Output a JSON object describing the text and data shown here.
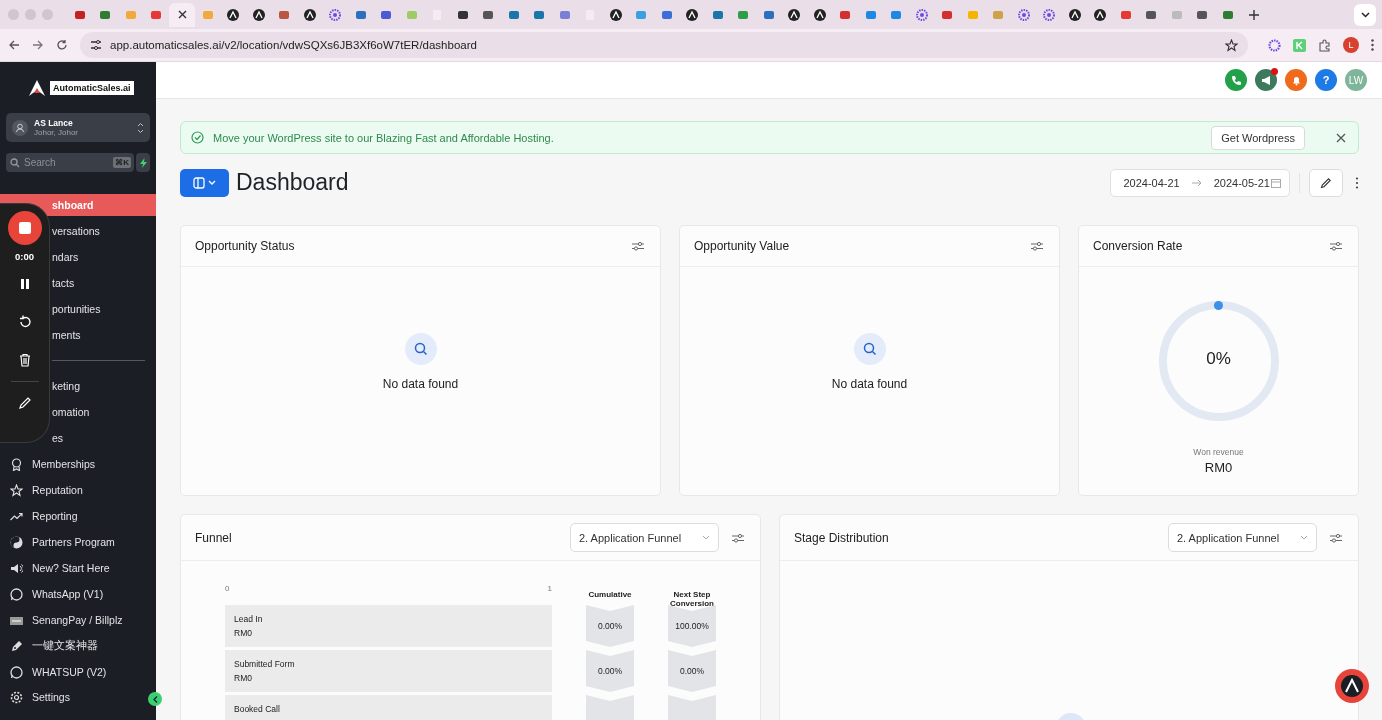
{
  "browser": {
    "tabs": [
      {
        "selected": false
      },
      {
        "selected": false
      },
      {
        "selected": false
      },
      {
        "selected": false
      },
      {
        "selected": true
      },
      {
        "selected": false
      },
      {
        "selected": false
      },
      {
        "selected": false
      },
      {
        "selected": false
      },
      {
        "selected": false
      },
      {
        "selected": false
      },
      {
        "selected": false
      },
      {
        "selected": false
      },
      {
        "selected": false
      },
      {
        "selected": false
      },
      {
        "selected": false
      },
      {
        "selected": false
      },
      {
        "selected": false
      },
      {
        "selected": false
      },
      {
        "selected": false
      },
      {
        "selected": false
      },
      {
        "selected": false
      },
      {
        "selected": false
      },
      {
        "selected": false
      },
      {
        "selected": false
      },
      {
        "selected": false
      },
      {
        "selected": false
      },
      {
        "selected": false
      },
      {
        "selected": false
      },
      {
        "selected": false
      },
      {
        "selected": false
      },
      {
        "selected": false
      },
      {
        "selected": false
      },
      {
        "selected": false
      },
      {
        "selected": false
      },
      {
        "selected": false
      },
      {
        "selected": false
      },
      {
        "selected": false
      },
      {
        "selected": false
      },
      {
        "selected": false
      },
      {
        "selected": false
      },
      {
        "selected": false
      },
      {
        "selected": false
      },
      {
        "selected": false
      },
      {
        "selected": false
      },
      {
        "selected": false
      }
    ],
    "url": "app.automaticsales.ai/v2/location/vdwSQXs6JB3Xf6oW7tER/dashboard",
    "profile": "L"
  },
  "sidebar": {
    "logo": "AutomaticSales.ai",
    "account": {
      "name": "AS Lance",
      "location": "Johor, Johor"
    },
    "search": {
      "placeholder": "Search",
      "shortcut": "⌘K"
    },
    "items": [
      {
        "label": "shboard",
        "selected": true,
        "partial": true
      },
      {
        "label": "versations",
        "selected": false,
        "partial": true
      },
      {
        "label": "ndars",
        "selected": false,
        "partial": true
      },
      {
        "label": "tacts",
        "selected": false,
        "partial": true
      },
      {
        "label": "portunities",
        "selected": false,
        "partial": true
      },
      {
        "label": "ments",
        "selected": false,
        "partial": true
      },
      {
        "kind": "divider"
      },
      {
        "label": "keting",
        "selected": false,
        "partial": true
      },
      {
        "label": "omation",
        "selected": false,
        "partial": true
      },
      {
        "label": "es",
        "selected": false,
        "partial": true
      },
      {
        "label": "Memberships",
        "selected": false
      },
      {
        "label": "Reputation",
        "selected": false
      },
      {
        "label": "Reporting",
        "selected": false
      },
      {
        "label": "Partners Program",
        "selected": false
      },
      {
        "label": "New? Start Here",
        "selected": false
      },
      {
        "label": "WhatsApp (V1)",
        "selected": false
      },
      {
        "label": "SenangPay / Billplz",
        "selected": false
      },
      {
        "label": "一键文案神器",
        "selected": false
      },
      {
        "label": "WHATSUP (V2)",
        "selected": false
      }
    ],
    "settings": "Settings"
  },
  "recorder": {
    "time": "0:00"
  },
  "header": {
    "avatar": "LW",
    "help": "?",
    "announcement_unread": true
  },
  "banner": {
    "message": "Move your WordPress site to our Blazing Fast and Affordable Hosting.",
    "button": "Get Wordpress"
  },
  "page": {
    "title": "Dashboard",
    "date_from": "2024-04-21",
    "date_to": "2024-05-21"
  },
  "widgets": [
    {
      "kind": "empty",
      "title": "Opportunity Status",
      "message": "No data found"
    },
    {
      "kind": "empty",
      "title": "Opportunity Value",
      "message": "No data found"
    },
    {
      "kind": "gauge",
      "title": "Conversion Rate",
      "value": "0%",
      "caption": "Won revenue",
      "amount": "RM0"
    }
  ],
  "funnel": {
    "title": "Funnel",
    "select": "2. Application Funnel",
    "axis_min": "0",
    "axis_max": "1",
    "columns": [
      "Cumulative",
      "Next Step Conversion"
    ],
    "steps": [
      {
        "name": "Lead In",
        "value": "RM0",
        "cumulative": "0.00%",
        "next_step": "100.00%"
      },
      {
        "name": "Submitted Form",
        "value": "RM0",
        "cumulative": "0.00%",
        "next_step": "0.00%"
      },
      {
        "name": "Booked Call"
      }
    ]
  },
  "stage_distribution": {
    "title": "Stage Distribution",
    "select": "2. Application Funnel"
  }
}
